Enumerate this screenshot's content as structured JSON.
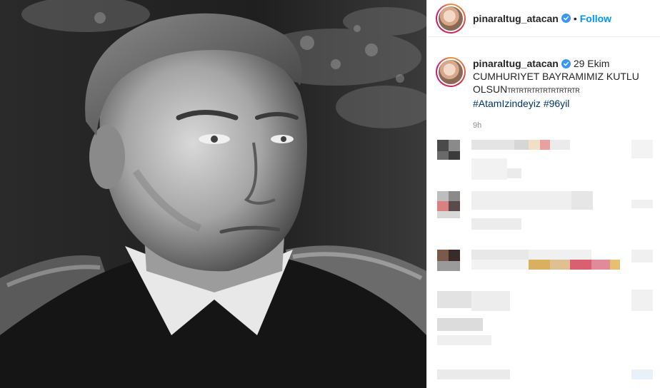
{
  "post": {
    "username": "pinaraltug_atacan",
    "follow_label": "Follow",
    "separator": "•"
  },
  "caption": {
    "username": "pinaraltug_atacan",
    "date": "29 Ekim",
    "text": "CUMHURIYET BAYRAMIMIZ KUTLU OLSUN",
    "tail": "TRTRTRTRTRTRTRTRTR",
    "hashtags": [
      "#AtamIzindeyiz",
      "#96yil"
    ],
    "time_fragment": "9h"
  },
  "photo": {
    "description_icon": "portrait-photo"
  },
  "colors": {
    "accent": "#0095f6",
    "verified": "#3897f0",
    "hashtag": "#00376b",
    "border": "#efefef"
  }
}
